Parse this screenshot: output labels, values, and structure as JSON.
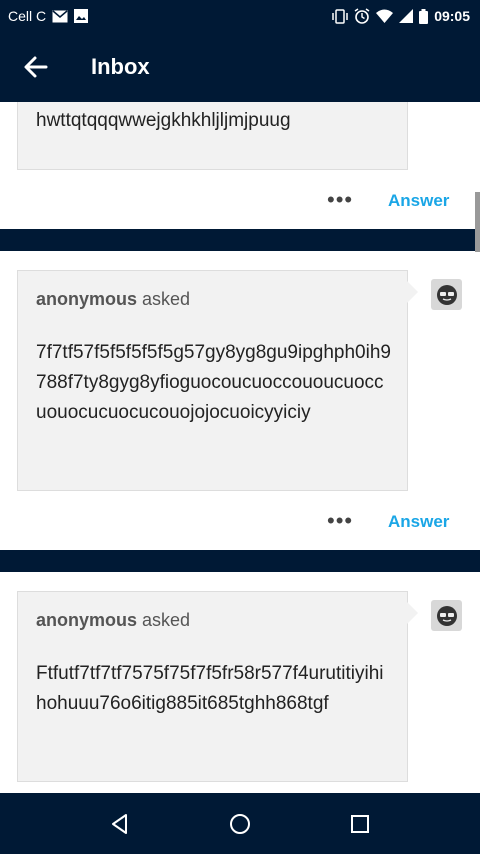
{
  "status": {
    "carrier": "Cell C",
    "time": "09:05",
    "icons": [
      "mail-icon",
      "image-icon",
      "vibrate-icon",
      "alarm-icon",
      "wifi-icon",
      "signal-icon",
      "battery-icon"
    ]
  },
  "appbar": {
    "title": "Inbox"
  },
  "questions": [
    {
      "asker": "",
      "asked": "",
      "text": "hwttqtqqqwwejgkhkhljljmjpuug",
      "answer_label": "Answer"
    },
    {
      "asker": "anonymous",
      "asked": "asked",
      "text": "7f7tf57f5f5f5f5f5g57gy8yg8gu9ipghph0ih9788f7ty8gyg8yfioguocoucuoccououcuoccuouocucuocucouojojocuoicyyiciy",
      "answer_label": "Answer"
    },
    {
      "asker": "anonymous",
      "asked": "asked",
      "text": "Ftfutf7tf7tf7575f75f7f5fr58r577f4urutitiyihihohuuu76o6itig885it685tghh868tgf",
      "answer_label": "Answer"
    }
  ],
  "colors": {
    "navy": "#001935",
    "accent": "#1aa6e6",
    "card": "#f2f2f2"
  }
}
